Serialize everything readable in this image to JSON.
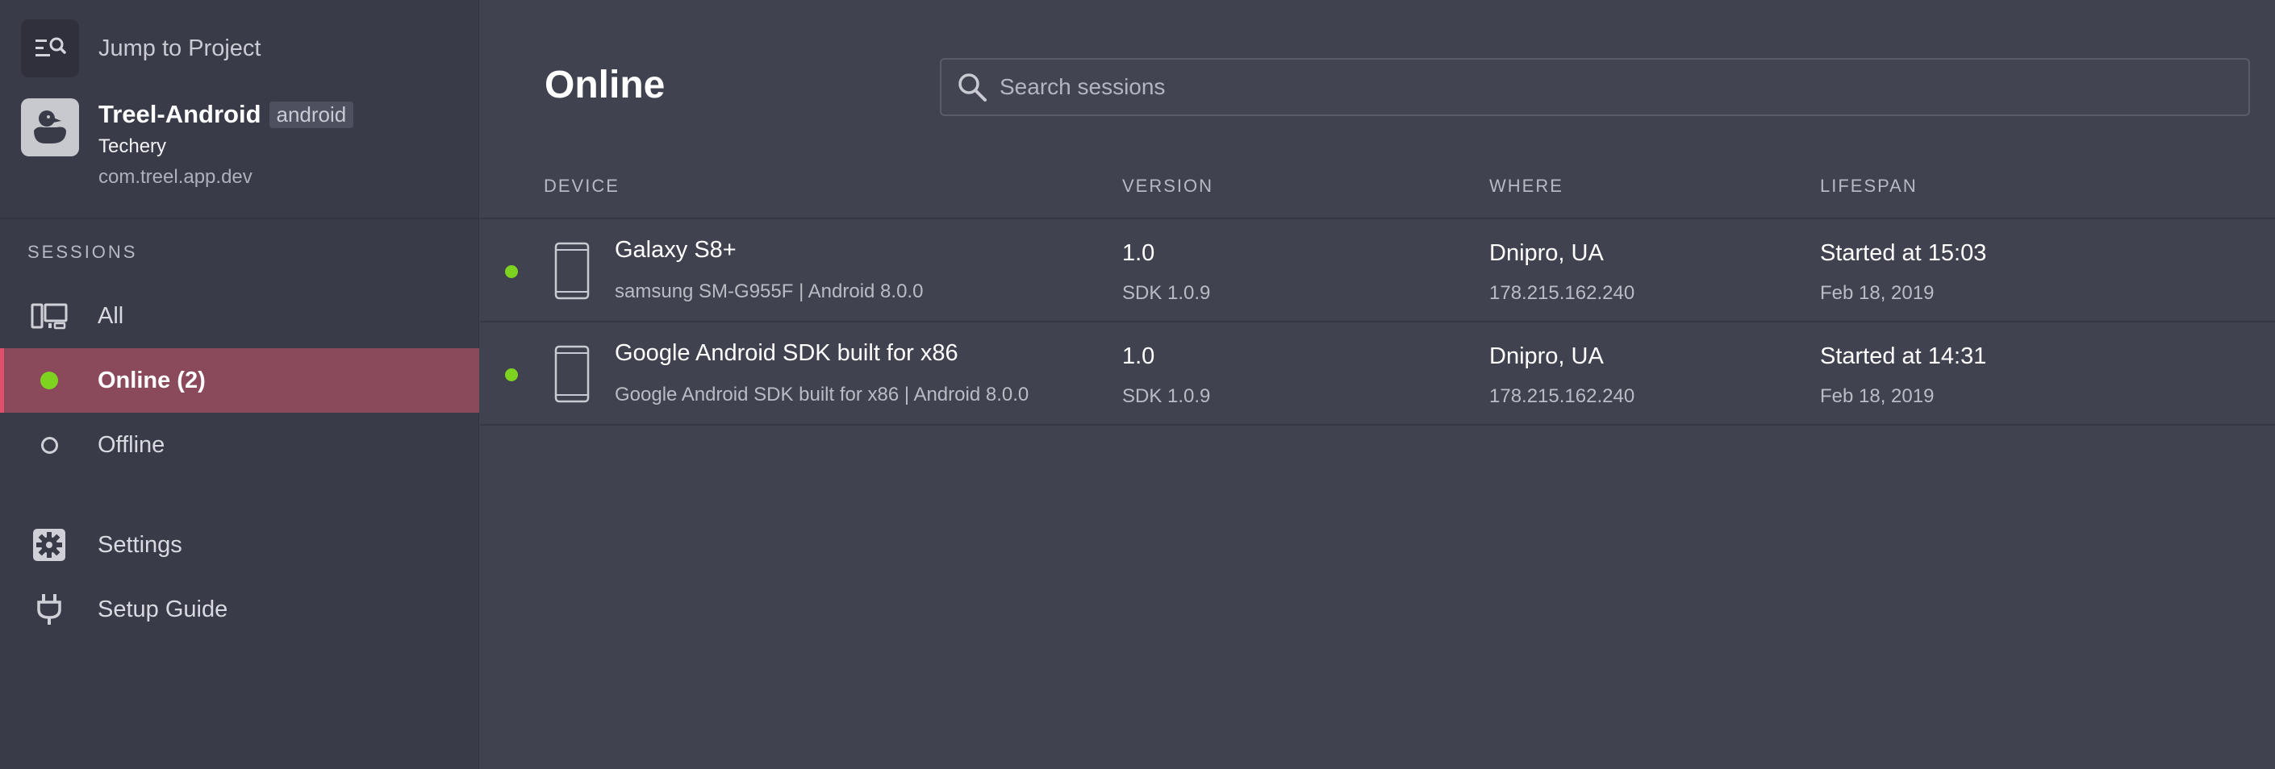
{
  "sidebar": {
    "jump_label": "Jump to Project",
    "project": {
      "name": "Treel-Android",
      "platform": "android",
      "org": "Techery",
      "bundle": "com.treel.app.dev"
    },
    "section_label": "SESSIONS",
    "items": [
      {
        "label": "All",
        "icon": "devices-icon"
      },
      {
        "label": "Online (2)",
        "icon": "online-dot-icon",
        "active": true
      },
      {
        "label": "Offline",
        "icon": "offline-dot-icon"
      },
      {
        "label": "Settings",
        "icon": "gear-icon"
      },
      {
        "label": "Setup Guide",
        "icon": "plug-icon"
      }
    ]
  },
  "main": {
    "title": "Online",
    "search": {
      "placeholder": "Search sessions"
    },
    "columns": [
      "DEVICE",
      "VERSION",
      "WHERE",
      "LIFESPAN"
    ],
    "rows": [
      {
        "status": "online",
        "device_name": "Galaxy S8+",
        "device_detail": "samsung SM-G955F | Android 8.0.0",
        "version": "1.0",
        "sdk": "SDK 1.0.9",
        "location": "Dnipro, UA",
        "ip": "178.215.162.240",
        "started": "Started at 15:03",
        "date": "Feb 18, 2019"
      },
      {
        "status": "online",
        "device_name": "Google Android SDK built for x86",
        "device_detail": "Google Android SDK built for x86 | Android 8.0.0",
        "version": "1.0",
        "sdk": "SDK 1.0.9",
        "location": "Dnipro, UA",
        "ip": "178.215.162.240",
        "started": "Started at 14:31",
        "date": "Feb 18, 2019"
      }
    ]
  },
  "colors": {
    "background": "#40424f",
    "sidebar": "#3a3b48",
    "active_item": "#8b4a5c",
    "active_accent": "#e0506d",
    "online": "#7ed321"
  }
}
